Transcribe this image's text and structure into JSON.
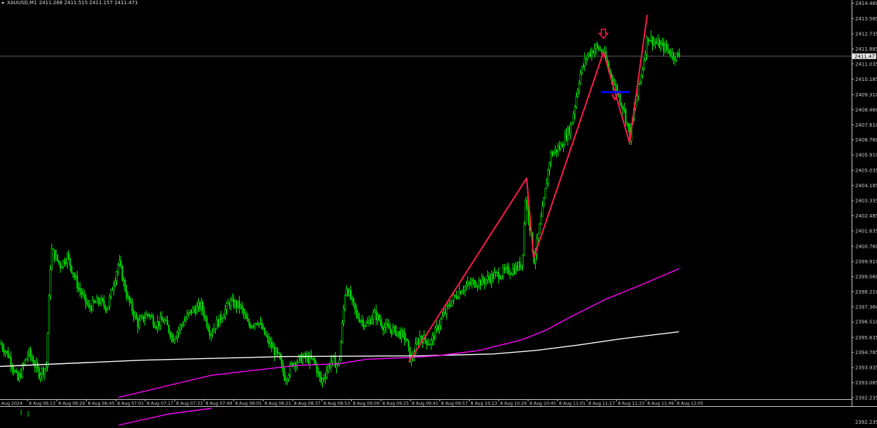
{
  "chart_header": {
    "symbol": "XAUUSD,M1",
    "ohlc": "2411.288 2411.515 2411.157 2411.471"
  },
  "colors": {
    "background": "#000000",
    "candles": "#00e600",
    "ma_fast": "#ff00ff",
    "ma_slow": "#ffffff",
    "drawing": "#ff1a4a",
    "marker": "#0000ff",
    "bid_line": "#808080",
    "axis_text": "#c8c8c8"
  },
  "chart_data": {
    "type": "candlestick",
    "x_axis_labels": [
      "Aug 2024",
      "8 Aug 06:13",
      "8 Aug 06:29",
      "8 Aug 06:45",
      "8 Aug 07:01",
      "8 Aug 07:17",
      "8 Aug 07:33",
      "8 Aug 07:49",
      "8 Aug 08:05",
      "8 Aug 08:21",
      "8 Aug 08:37",
      "8 Aug 08:53",
      "8 Aug 09:09",
      "8 Aug 09:25",
      "8 Aug 09:41",
      "8 Aug 09:57",
      "8 Aug 10:13",
      "8 Aug 10:29",
      "8 Aug 10:45",
      "8 Aug 11:01",
      "8 Aug 11:17",
      "8 Aug 11:33",
      "8 Aug 11:49",
      "8 Aug 12:05"
    ],
    "y_axis_labels": [
      "2414.460",
      "2413.585",
      "2412.735",
      "2411.885",
      "2411.035",
      "2410.185",
      "2409.310",
      "2408.460",
      "2407.610",
      "2406.760",
      "2405.910",
      "2405.035",
      "2404.185",
      "2403.335",
      "2402.485",
      "2401.635",
      "2400.760",
      "2399.910",
      "2399.060",
      "2398.210",
      "2397.360",
      "2396.510",
      "2395.635",
      "2394.785",
      "2393.935",
      "2393.085",
      "2392.235"
    ],
    "current_price": "2411.471",
    "sub_window_label": "2392.235",
    "y_range": [
      2392.235,
      2414.46
    ],
    "price_path": [
      [
        0,
        2395.3
      ],
      [
        12,
        2394.6
      ],
      [
        25,
        2393.2
      ],
      [
        40,
        2394.8
      ],
      [
        55,
        2393.6
      ],
      [
        65,
        2394.0
      ],
      [
        72,
        2400.6
      ],
      [
        85,
        2399.7
      ],
      [
        95,
        2400.2
      ],
      [
        110,
        2398.5
      ],
      [
        125,
        2397.3
      ],
      [
        140,
        2397.7
      ],
      [
        152,
        2397.3
      ],
      [
        160,
        2398.6
      ],
      [
        168,
        2399.9
      ],
      [
        180,
        2397.9
      ],
      [
        195,
        2396.4
      ],
      [
        210,
        2397.0
      ],
      [
        220,
        2396.4
      ],
      [
        232,
        2396.6
      ],
      [
        245,
        2395.6
      ],
      [
        258,
        2396.4
      ],
      [
        270,
        2397.1
      ],
      [
        285,
        2397.4
      ],
      [
        298,
        2395.9
      ],
      [
        312,
        2396.7
      ],
      [
        325,
        2397.6
      ],
      [
        340,
        2397.4
      ],
      [
        352,
        2396.3
      ],
      [
        365,
        2396.6
      ],
      [
        380,
        2395.4
      ],
      [
        395,
        2394.5
      ],
      [
        404,
        2393.3
      ],
      [
        415,
        2394.2
      ],
      [
        430,
        2394.5
      ],
      [
        445,
        2394.3
      ],
      [
        455,
        2393.1
      ],
      [
        470,
        2394.4
      ],
      [
        480,
        2394.0
      ],
      [
        490,
        2398.6
      ],
      [
        505,
        2396.9
      ],
      [
        520,
        2396.3
      ],
      [
        530,
        2397.0
      ],
      [
        545,
        2396.2
      ],
      [
        560,
        2396.0
      ],
      [
        575,
        2395.6
      ],
      [
        582,
        2394.3
      ],
      [
        595,
        2395.7
      ],
      [
        610,
        2395.3
      ],
      [
        625,
        2396.6
      ],
      [
        640,
        2397.7
      ],
      [
        655,
        2398.4
      ],
      [
        670,
        2398.7
      ],
      [
        685,
        2398.8
      ],
      [
        700,
        2399.1
      ],
      [
        715,
        2399.3
      ],
      [
        730,
        2399.5
      ],
      [
        740,
        2399.8
      ],
      [
        745,
        2403.5
      ],
      [
        752,
        2401.6
      ],
      [
        757,
        2400.0
      ],
      [
        770,
        2403.0
      ],
      [
        780,
        2405.9
      ],
      [
        795,
        2406.4
      ],
      [
        810,
        2407.6
      ],
      [
        822,
        2410.4
      ],
      [
        832,
        2411.5
      ],
      [
        845,
        2412.0
      ],
      [
        855,
        2411.7
      ],
      [
        865,
        2410.5
      ],
      [
        875,
        2409.5
      ],
      [
        885,
        2408.4
      ],
      [
        893,
        2406.9
      ],
      [
        900,
        2408.7
      ],
      [
        910,
        2410.6
      ],
      [
        918,
        2412.6
      ],
      [
        930,
        2412.2
      ],
      [
        945,
        2411.9
      ],
      [
        955,
        2411.5
      ],
      [
        963,
        2411.5
      ]
    ],
    "ma_fast_path": [
      [
        168,
        2392.25
      ],
      [
        300,
        2393.5
      ],
      [
        420,
        2394.05
      ],
      [
        480,
        2394.15
      ],
      [
        520,
        2394.4
      ],
      [
        580,
        2394.5
      ],
      [
        620,
        2394.6
      ],
      [
        680,
        2394.9
      ],
      [
        740,
        2395.5
      ],
      [
        775,
        2396.05
      ],
      [
        810,
        2396.8
      ],
      [
        860,
        2397.8
      ],
      [
        910,
        2398.6
      ],
      [
        963,
        2399.5
      ]
    ],
    "ma_slow_path": [
      [
        0,
        2394.0
      ],
      [
        200,
        2394.35
      ],
      [
        400,
        2394.55
      ],
      [
        600,
        2394.6
      ],
      [
        700,
        2394.7
      ],
      [
        760,
        2394.9
      ],
      [
        820,
        2395.2
      ],
      [
        880,
        2395.55
      ],
      [
        963,
        2395.95
      ]
    ],
    "zigzag_1": [
      [
        580,
        2394.25
      ],
      [
        747,
        2404.6
      ],
      [
        757,
        2400.1
      ],
      [
        856,
        2411.7
      ],
      [
        893,
        2406.6
      ],
      [
        918,
        2413.8
      ]
    ],
    "arrow_down": [
      856,
      2412.6
    ],
    "check_mark": [
      872,
      2409.2
    ],
    "horizontal_level": {
      "price": 2409.45,
      "x_start": 853,
      "x_end": 893
    }
  }
}
